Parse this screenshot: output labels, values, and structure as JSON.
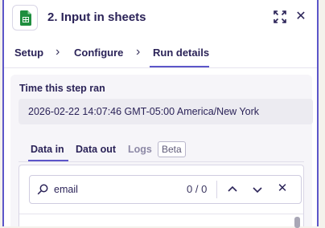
{
  "header": {
    "title": "2. Input in sheets",
    "app_icon": "google-sheets-icon"
  },
  "steps": [
    {
      "label": "Setup"
    },
    {
      "label": "Configure"
    },
    {
      "label": "Run details",
      "active": true
    }
  ],
  "run_details": {
    "time_label": "Time this step ran",
    "timestamp": "2026-02-22 14:07:46 GMT-05:00 America/New York"
  },
  "data_tabs": {
    "data_in": "Data in",
    "data_out": "Data out",
    "logs": "Logs",
    "logs_badge": "Beta",
    "active": "Data in"
  },
  "search": {
    "value": "email",
    "match_count": "0 / 0"
  },
  "colors": {
    "accent": "#5c56c9",
    "text": "#2b2358",
    "sheets_green": "#1e8e3e"
  }
}
